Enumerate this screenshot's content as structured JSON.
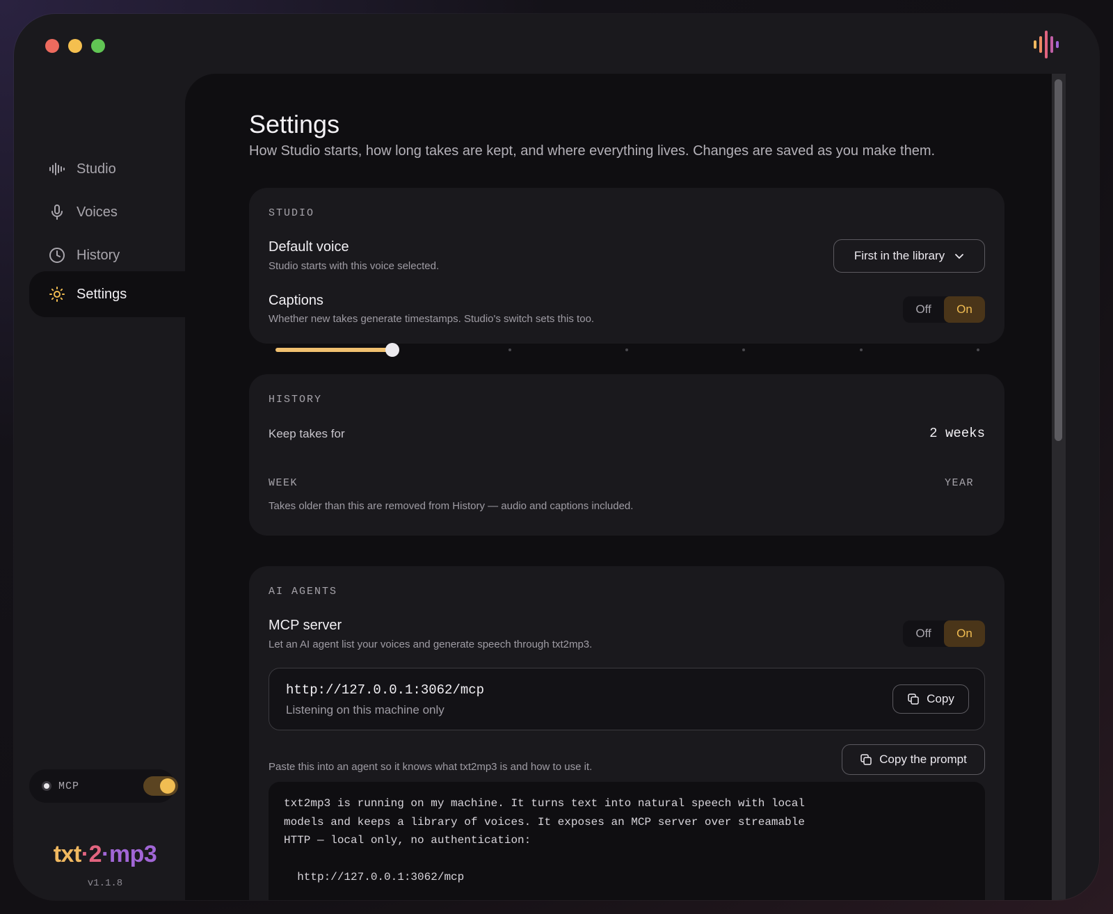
{
  "sidebar": {
    "items": [
      {
        "label": "Studio",
        "icon": "waveform-icon"
      },
      {
        "label": "Voices",
        "icon": "microphone-icon"
      },
      {
        "label": "History",
        "icon": "clock-icon"
      },
      {
        "label": "Settings",
        "icon": "sun-icon"
      }
    ],
    "mcp_label": "MCP",
    "mcp_toggle_on": true,
    "brand": {
      "part1": "txt",
      "sep1": "·",
      "part2": "2",
      "sep2": "·",
      "part3": "mp3"
    },
    "version": "v1.1.8"
  },
  "page": {
    "title": "Settings",
    "subtitle": "How Studio starts, how long takes are kept, and where everything lives. Changes are saved as you make them."
  },
  "studio": {
    "section_label": "STUDIO",
    "default_voice": {
      "title": "Default voice",
      "desc": "Studio starts with this voice selected.",
      "value": "First in the library"
    },
    "captions": {
      "title": "Captions",
      "desc": "Whether new takes generate timestamps. Studio's switch sets this too.",
      "off_label": "Off",
      "on_label": "On",
      "selected": "On"
    }
  },
  "history": {
    "section_label": "HISTORY",
    "keep_label": "Keep takes for",
    "keep_value": "2 weeks",
    "slider_fraction": 0.166,
    "min_label": "WEEK",
    "max_label": "YEAR",
    "note": "Takes older than this are removed from History — audio and captions included."
  },
  "ai_agents": {
    "section_label": "AI AGENTS",
    "mcp_server": {
      "title": "MCP server",
      "desc": "Let an AI agent list your voices and generate speech through txt2mp3.",
      "off_label": "Off",
      "on_label": "On",
      "selected": "On"
    },
    "url": "http://127.0.0.1:3062/mcp",
    "url_status": "Listening on this machine only",
    "copy_label": "Copy",
    "prompt_hint": "Paste this into an agent so it knows what txt2mp3 is and how to use it.",
    "copy_prompt_label": "Copy the prompt",
    "prompt_text": "txt2mp3 is running on my machine. It turns text into natural speech with local\nmodels and keeps a library of voices. It exposes an MCP server over streamable\nHTTP — local only, no authentication:\n\n  http://127.0.0.1:3062/mcp"
  },
  "colors": {
    "accent": "#f1bd52",
    "brand_orange": "#f0b860",
    "brand_pink": "#e2647f",
    "brand_purple": "#a166d6"
  }
}
